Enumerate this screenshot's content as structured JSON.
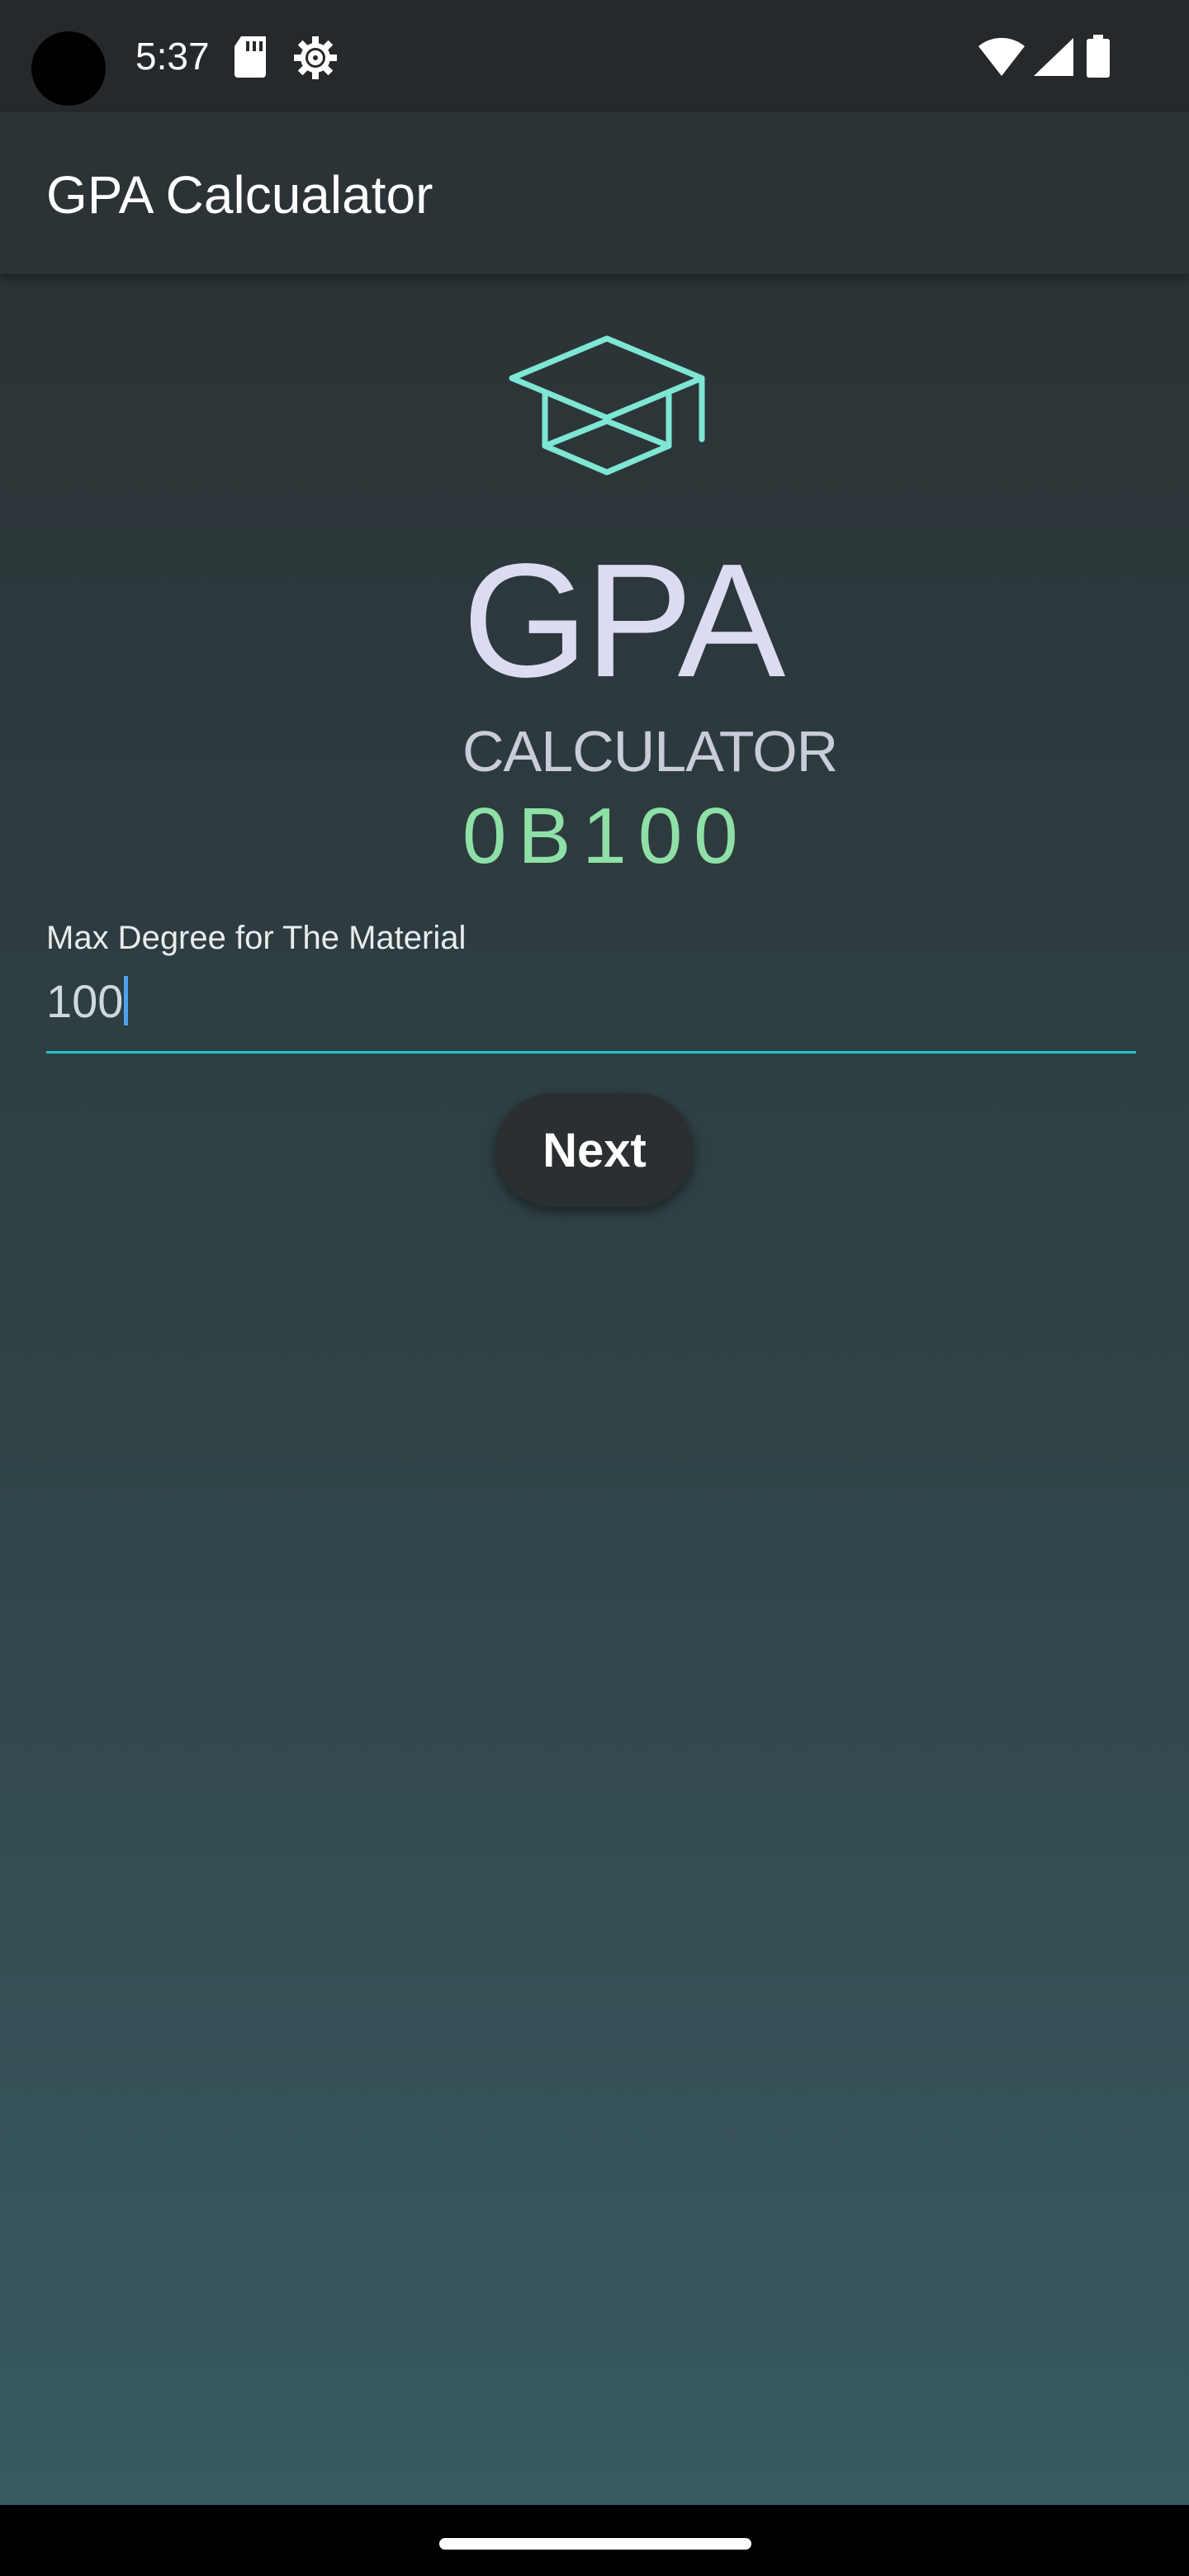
{
  "status_bar": {
    "time": "5:37",
    "icons": [
      "sd-card-icon",
      "settings-icon",
      "wifi-icon",
      "signal-icon",
      "battery-icon"
    ]
  },
  "app_bar": {
    "title": "GPA Calcualator"
  },
  "logo": {
    "icon": "graduation-cap-icon",
    "title": "GPA",
    "subtitle": "CALCULATOR",
    "code": "0B100"
  },
  "form": {
    "label": "Max Degree for The Material",
    "value": "100",
    "next_label": "Next"
  },
  "colors": {
    "background": "#2b3336",
    "accent": "#23c3c8",
    "logo_text": "#dbdcf2",
    "logo_code": "#8fe0a6",
    "cap_outline": "#7ee6d4"
  }
}
